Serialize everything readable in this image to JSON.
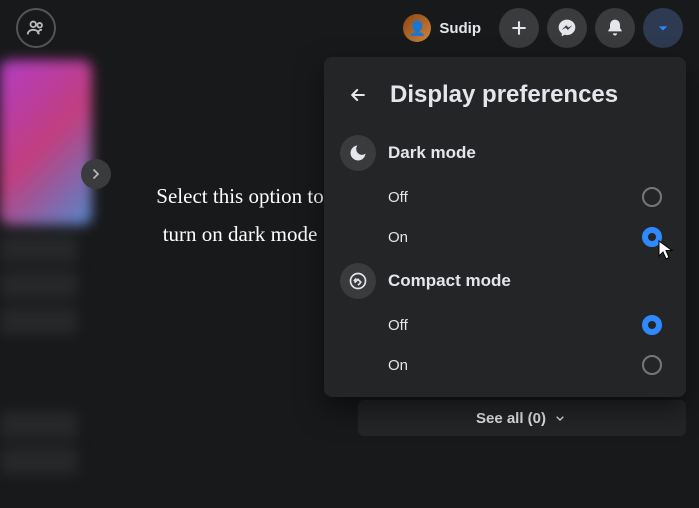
{
  "topbar": {
    "user_name": "Sudip"
  },
  "annotation": {
    "text": "Select this option to turn on dark mode"
  },
  "panel": {
    "title": "Display preferences",
    "dark_mode": {
      "title": "Dark mode",
      "off_label": "Off",
      "on_label": "On",
      "selected": "on"
    },
    "compact_mode": {
      "title": "Compact mode",
      "off_label": "Off",
      "on_label": "On",
      "selected": "off"
    }
  },
  "see_all": {
    "label": "See all (0)"
  }
}
